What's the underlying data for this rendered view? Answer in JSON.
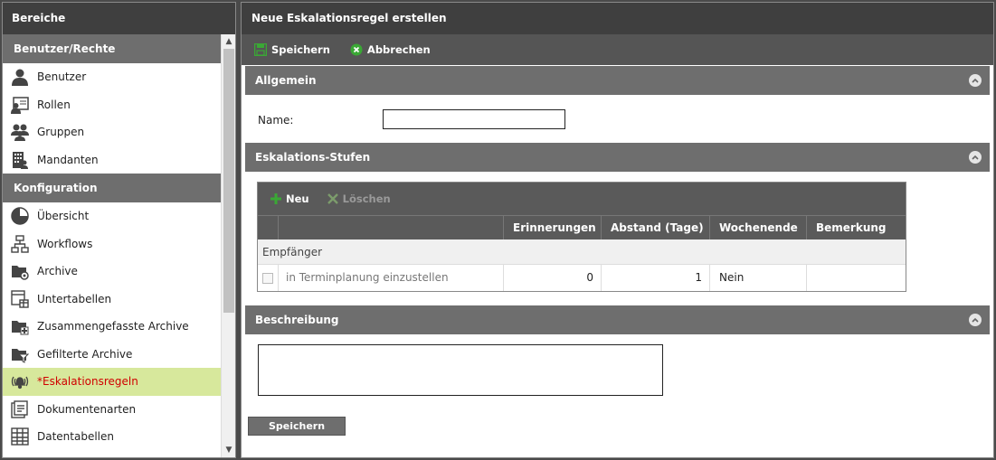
{
  "sidebar": {
    "title": "Bereiche",
    "sections": [
      {
        "title": "Benutzer/Rechte",
        "items": [
          {
            "label": "Benutzer",
            "icon": "user-icon"
          },
          {
            "label": "Rollen",
            "icon": "role-icon"
          },
          {
            "label": "Gruppen",
            "icon": "group-icon"
          },
          {
            "label": "Mandanten",
            "icon": "tenant-icon"
          }
        ]
      },
      {
        "title": "Konfiguration",
        "items": [
          {
            "label": "Übersicht",
            "icon": "pie-chart-icon"
          },
          {
            "label": "Workflows",
            "icon": "workflow-icon"
          },
          {
            "label": "Archive",
            "icon": "archive-settings-icon"
          },
          {
            "label": "Untertabellen",
            "icon": "subtable-icon"
          },
          {
            "label": "Zusammengefasste Archive",
            "icon": "merged-archive-icon"
          },
          {
            "label": "Gefilterte Archive",
            "icon": "filter-archive-icon"
          },
          {
            "label": "*Eskalationsregeln",
            "icon": "alarm-bell-icon",
            "active": true
          },
          {
            "label": "Dokumentenarten",
            "icon": "document-types-icon"
          },
          {
            "label": "Datentabellen",
            "icon": "data-table-icon"
          }
        ]
      }
    ]
  },
  "main": {
    "title": "Neue Eskalationsregel erstellen",
    "toolbar": {
      "save": "Speichern",
      "cancel": "Abbrechen"
    },
    "general": {
      "title": "Allgemein",
      "name_label": "Name:",
      "name_value": ""
    },
    "levels": {
      "title": "Eskalations-Stufen",
      "toolbar": {
        "new": "Neu",
        "delete": "Löschen"
      },
      "columns": [
        "Erinnerungen",
        "Abstand (Tage)",
        "Wochenende",
        "Bemerkung"
      ],
      "group_label": "Empfänger",
      "rows": [
        {
          "recipient": "in Terminplanung einzustellen",
          "reminders": "0",
          "interval": "1",
          "weekend": "Nein",
          "remark": ""
        }
      ]
    },
    "description": {
      "title": "Beschreibung",
      "value": ""
    },
    "save_button": "Speichern"
  },
  "colors": {
    "active_bg": "#d7e89c",
    "active_text": "#d00000",
    "header_dark": "#3f3f3f",
    "section_gray": "#6e6e6e",
    "save_green": "#3aa835"
  }
}
